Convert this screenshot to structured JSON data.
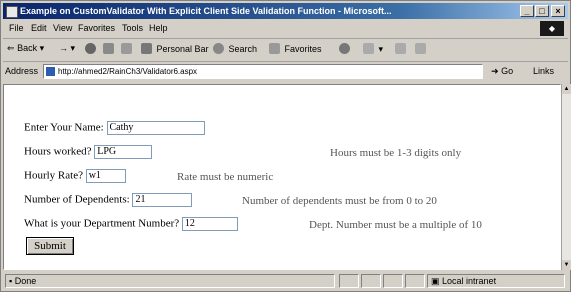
{
  "window": {
    "title": "Example on CustomValidator With Explicit Client Side Validation Function - Microsoft...",
    "controls": [
      "_",
      "□",
      "×"
    ]
  },
  "menu": [
    "File",
    "Edit",
    "View",
    "Favorites",
    "Tools",
    "Help"
  ],
  "toolbar": {
    "back": "Back",
    "search": "Search",
    "favorites": "Favorites",
    "personal_bar": "Personal Bar"
  },
  "address": {
    "label": "Address",
    "url": "http://ahmed2/RainCh3/Validator6.aspx",
    "go": "Go",
    "links": "Links"
  },
  "form": {
    "name_label": "Enter Your Name:",
    "name_value": "Cathy",
    "hours_label": "Hours worked?",
    "hours_value": "LPG",
    "hours_error": "Hours must be 1-3 digits only",
    "rate_label": "Hourly Rate?",
    "rate_value": "w1",
    "rate_error": "Rate must be numeric",
    "dependents_label": "Number of Dependents:",
    "dependents_value": "21",
    "dependents_error": "Number of dependents must be from 0 to 20",
    "dept_label": "What is your Department Number?",
    "dept_value": "12",
    "dept_error": "Dept. Number must be a multiple of 10",
    "submit": "Submit"
  },
  "status": {
    "text": "Done",
    "zone": "Local intranet"
  },
  "colors": {
    "title_start": "#0a246a",
    "title_end": "#a6caf0",
    "chrome": "#d4d0c8"
  }
}
